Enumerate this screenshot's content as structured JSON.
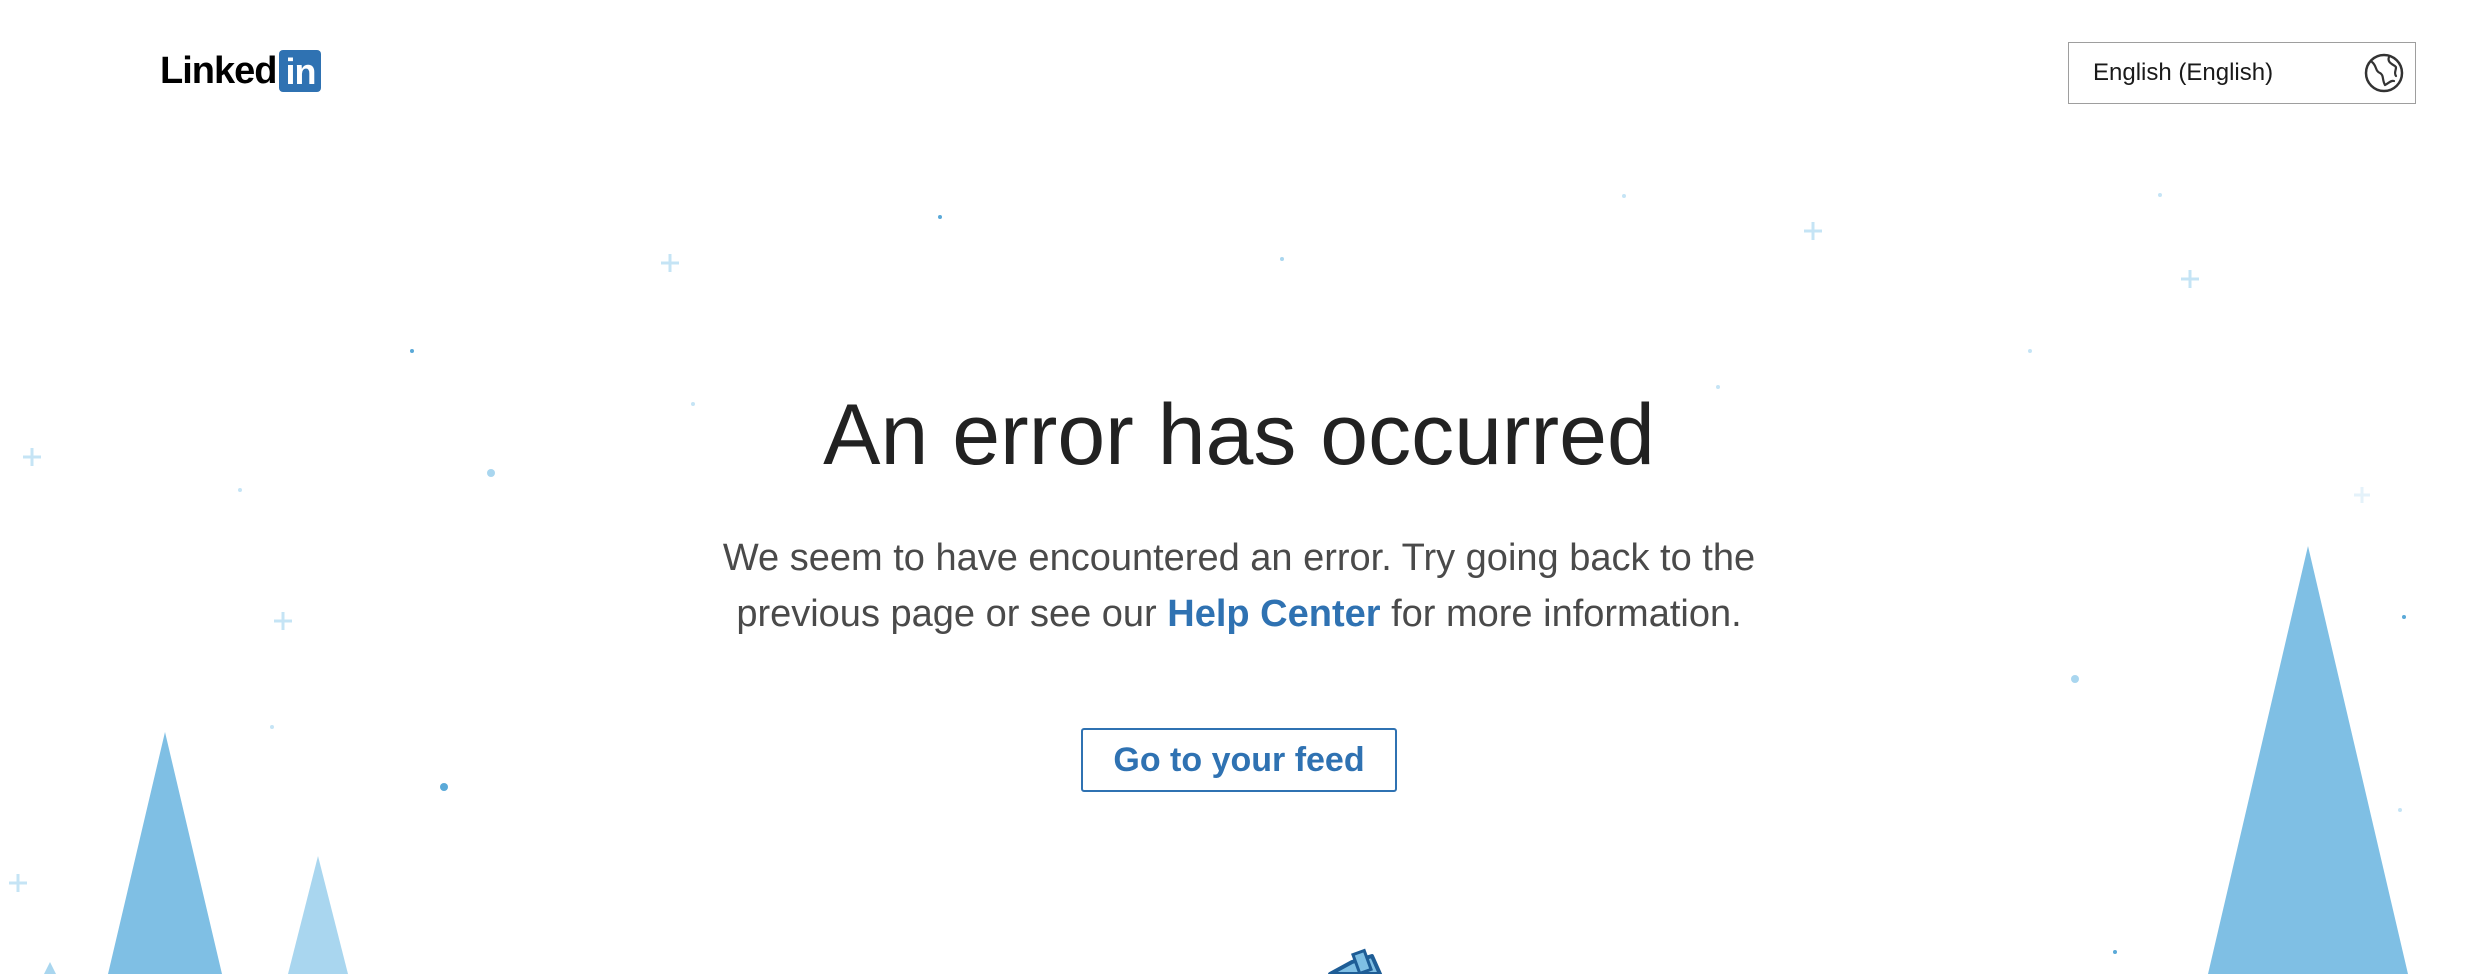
{
  "header": {
    "logo_text": "Linked",
    "logo_badge": "in",
    "brand_color": "#2f72b2",
    "language_select": {
      "selected": "English (English)",
      "icon": "globe-icon"
    }
  },
  "main": {
    "title": "An error has occurred",
    "description_before_link": "We seem to have encountered an error. Try going back to the previous page or see our ",
    "help_link_label": "Help Center",
    "description_after_link": " for more information.",
    "feed_button_label": "Go to your feed"
  },
  "decor_colors": {
    "tree_dark": "#7fbfe4",
    "tree_light": "#a9d6ef",
    "sparkle": "#c5e4f5",
    "dot": "#5aa9d8"
  }
}
